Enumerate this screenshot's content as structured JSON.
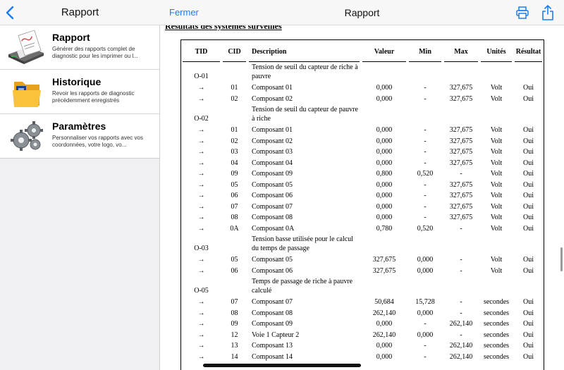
{
  "left": {
    "nav_title": "Rapport",
    "items": [
      {
        "title": "Rapport",
        "description": "Générer des rapports complet de diagnostic pour les imprimer ou l...",
        "icon": "report-printer-icon"
      },
      {
        "title": "Historique",
        "description": "Revoir les rapports de diagnostic précédemment enregistrés",
        "icon": "folder-history-icon"
      },
      {
        "title": "Paramètres",
        "description": "Personnaliser vos rapports avec vos coordonnées, votre logo, vo...",
        "icon": "gears-settings-icon"
      }
    ]
  },
  "right": {
    "close_label": "Fermer",
    "nav_title": "Rapport",
    "section_title": "Résultats des systèmes surveillés",
    "columns": [
      "TID",
      "CID",
      "Description",
      "Valeur",
      "Min",
      "Max",
      "Unités",
      "Résultat"
    ],
    "groups": [
      {
        "tid": "O-01",
        "description": "Tension de seuil du capteur de riche à pauvre",
        "rows": [
          {
            "arrow": "→",
            "cid": "01",
            "desc": "Composant 01",
            "val": "0,000",
            "min": "-",
            "max": "327,675",
            "unit": "Volt",
            "res": "Oui"
          },
          {
            "arrow": "→",
            "cid": "02",
            "desc": "Composant 02",
            "val": "0,000",
            "min": "-",
            "max": "327,675",
            "unit": "Volt",
            "res": "Oui"
          }
        ]
      },
      {
        "tid": "O-02",
        "description": "Tension de seuil du capteur de pauvre à riche",
        "rows": [
          {
            "arrow": "→",
            "cid": "01",
            "desc": "Composant 01",
            "val": "0,000",
            "min": "-",
            "max": "327,675",
            "unit": "Volt",
            "res": "Oui"
          },
          {
            "arrow": "→",
            "cid": "02",
            "desc": "Composant 02",
            "val": "0,000",
            "min": "-",
            "max": "327,675",
            "unit": "Volt",
            "res": "Oui"
          },
          {
            "arrow": "→",
            "cid": "03",
            "desc": "Composant 03",
            "val": "0,000",
            "min": "-",
            "max": "327,675",
            "unit": "Volt",
            "res": "Oui"
          },
          {
            "arrow": "→",
            "cid": "04",
            "desc": "Composant 04",
            "val": "0,000",
            "min": "-",
            "max": "327,675",
            "unit": "Volt",
            "res": "Oui"
          },
          {
            "arrow": "→",
            "cid": "09",
            "desc": "Composant 09",
            "val": "0,800",
            "min": "0,520",
            "max": "-",
            "unit": "Volt",
            "res": "Oui"
          },
          {
            "arrow": "→",
            "cid": "05",
            "desc": "Composant 05",
            "val": "0,000",
            "min": "-",
            "max": "327,675",
            "unit": "Volt",
            "res": "Oui"
          },
          {
            "arrow": "→",
            "cid": "06",
            "desc": "Composant 06",
            "val": "0,000",
            "min": "-",
            "max": "327,675",
            "unit": "Volt",
            "res": "Oui"
          },
          {
            "arrow": "→",
            "cid": "07",
            "desc": "Composant 07",
            "val": "0,000",
            "min": "-",
            "max": "327,675",
            "unit": "Volt",
            "res": "Oui"
          },
          {
            "arrow": "→",
            "cid": "08",
            "desc": "Composant 08",
            "val": "0,000",
            "min": "-",
            "max": "327,675",
            "unit": "Volt",
            "res": "Oui"
          },
          {
            "arrow": "→",
            "cid": "0A",
            "desc": "Composant 0A",
            "val": "0,780",
            "min": "0,520",
            "max": "-",
            "unit": "Volt",
            "res": "Oui"
          }
        ]
      },
      {
        "tid": "O-03",
        "description": "Tension basse utilisée pour le calcul du temps de passage",
        "rows": [
          {
            "arrow": "→",
            "cid": "05",
            "desc": "Composant 05",
            "val": "327,675",
            "min": "0,000",
            "max": "-",
            "unit": "Volt",
            "res": "Oui"
          },
          {
            "arrow": "→",
            "cid": "06",
            "desc": "Composant 06",
            "val": "327,675",
            "min": "0,000",
            "max": "-",
            "unit": "Volt",
            "res": "Oui"
          }
        ]
      },
      {
        "tid": "O-05",
        "description": "Temps de passage de riche à pauvre calculé",
        "rows": [
          {
            "arrow": "→",
            "cid": "07",
            "desc": "Composant 07",
            "val": "50,684",
            "min": "15,728",
            "max": "-",
            "unit": "secondes",
            "res": "Oui"
          },
          {
            "arrow": "→",
            "cid": "08",
            "desc": "Composant 08",
            "val": "262,140",
            "min": "0,000",
            "max": "-",
            "unit": "secondes",
            "res": "Oui"
          },
          {
            "arrow": "→",
            "cid": "09",
            "desc": "Composant 09",
            "val": "0,000",
            "min": "-",
            "max": "262,140",
            "unit": "secondes",
            "res": "Oui"
          },
          {
            "arrow": "→",
            "cid": "12",
            "desc": "Voie 1 Capteur 2",
            "val": "262,140",
            "min": "0,000",
            "max": "-",
            "unit": "secondes",
            "res": "Oui"
          },
          {
            "arrow": "→",
            "cid": "13",
            "desc": "Composant 13",
            "val": "0,000",
            "min": "-",
            "max": "262,140",
            "unit": "secondes",
            "res": "Oui"
          },
          {
            "arrow": "→",
            "cid": "14",
            "desc": "Composant 14",
            "val": "0,000",
            "min": "-",
            "max": "262,140",
            "unit": "secondes",
            "res": "Oui"
          }
        ]
      }
    ]
  },
  "colors": {
    "accent": "#1a7df0",
    "nav_bg": "#f7f7f7",
    "sidebar_bg": "#efeff4"
  }
}
